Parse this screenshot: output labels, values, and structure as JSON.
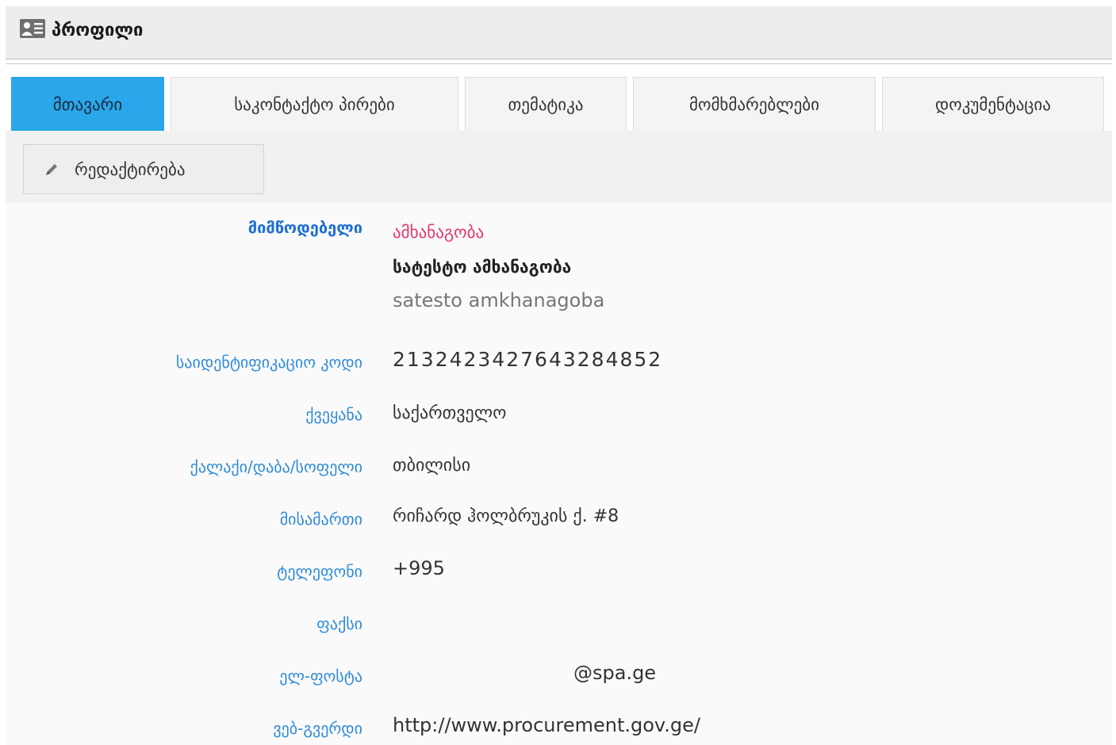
{
  "header": {
    "title": "პროფილი",
    "icon": "profile-card-icon"
  },
  "tabs": [
    {
      "label": "მთავარი",
      "active": true
    },
    {
      "label": "საკონტაქტო პირები",
      "active": false
    },
    {
      "label": "თემატიკა",
      "active": false
    },
    {
      "label": "მომხმარებლები",
      "active": false
    },
    {
      "label": "დოკუმენტაცია",
      "active": false
    }
  ],
  "toolbar": {
    "edit_label": "რედაქტირება",
    "edit_icon": "pencil-icon"
  },
  "profile": {
    "supplier_label": "მიმწოდებელი",
    "supplier_type": "ამხანაგობა",
    "supplier_name_ka": "სატესტო ამხანაგობა",
    "supplier_name_en": "satesto amkhanagoba",
    "id_code_label": "საიდენტიფიკაციო კოდი",
    "id_code": "2132423427643284852",
    "country_label": "ქვეყანა",
    "country": "საქართველო",
    "city_label": "ქალაქი/დაბა/სოფელი",
    "city": "თბილისი",
    "address_label": "მისამართი",
    "address": "რიჩარდ ჰოლბრუკის ქ. #8",
    "phone_label": "ტელეფონი",
    "phone": "+995",
    "fax_label": "ფაქსი",
    "fax": "",
    "email_label": "ელ-ფოსტა",
    "email": "@spa.ge",
    "website_label": "ვებ-გვერდი",
    "website": "http://www.procurement.gov.ge/"
  },
  "colors": {
    "active_tab": "#2aa7ea",
    "label": "#2e8bd9",
    "supplier_type": "#e8336e"
  }
}
